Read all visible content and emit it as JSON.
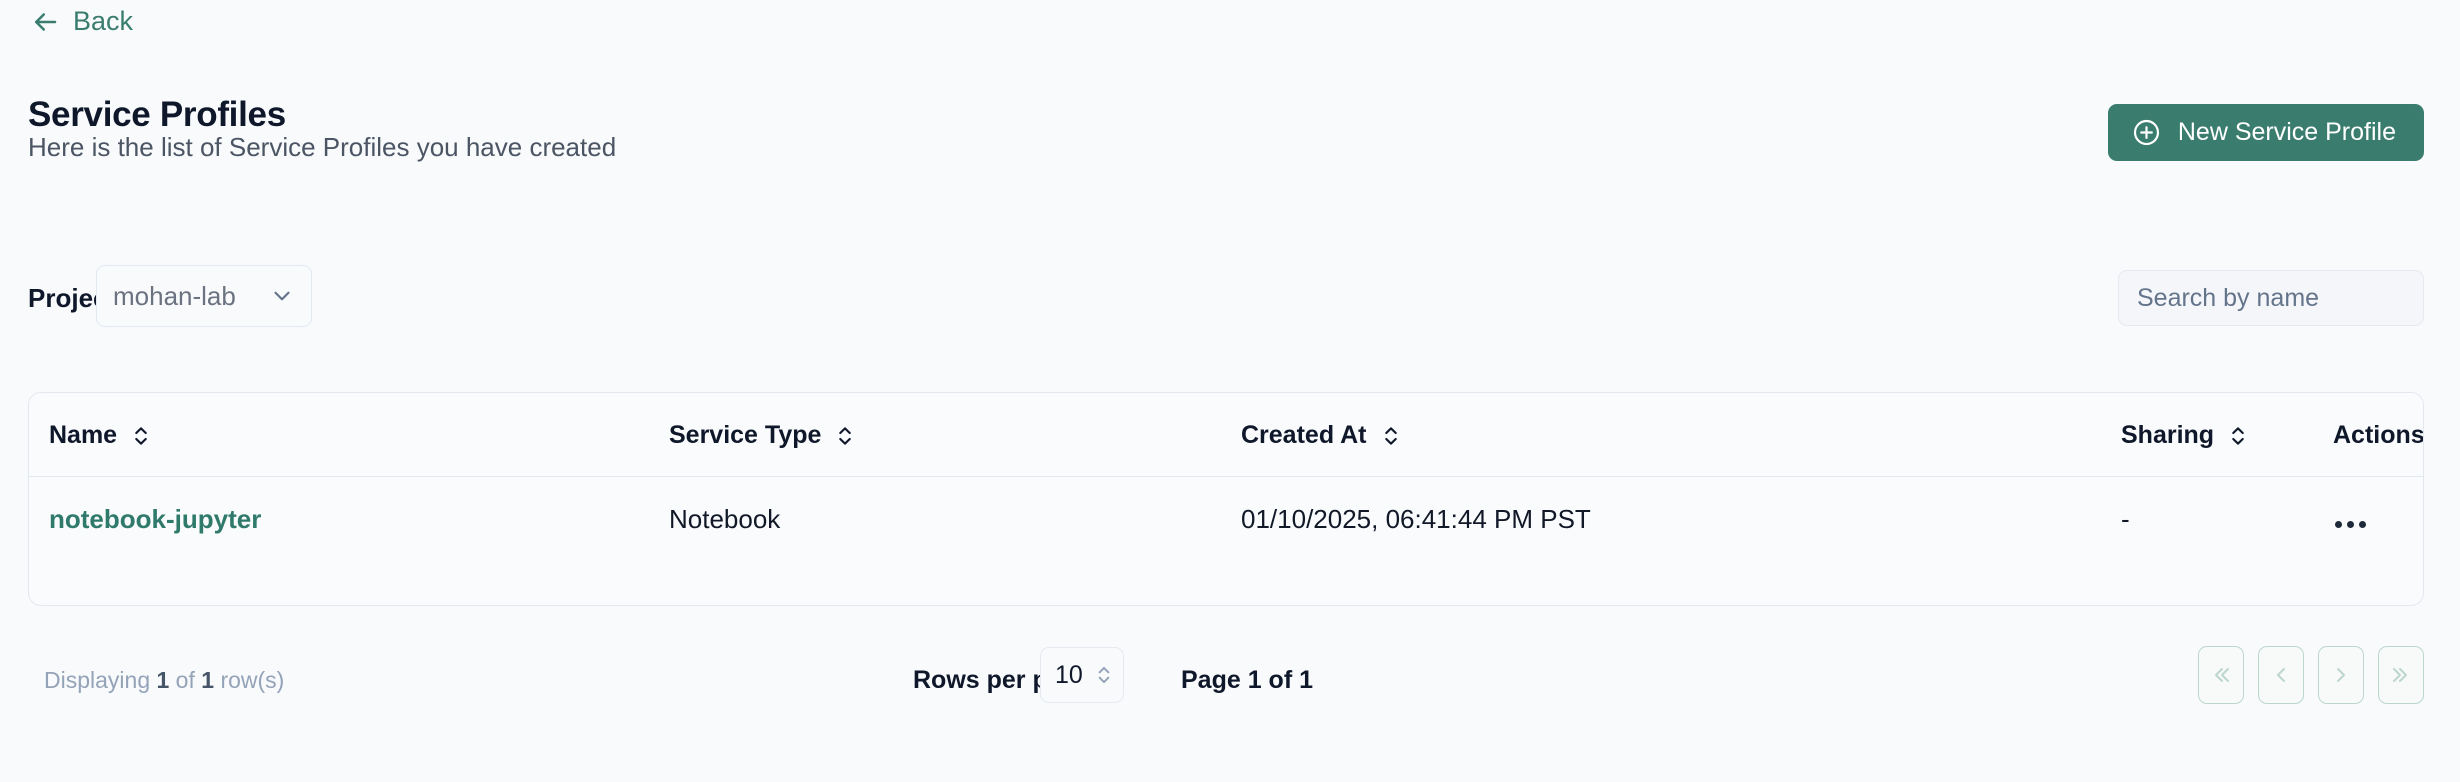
{
  "nav": {
    "back_label": "Back",
    "back_icon": "arrow-left-icon"
  },
  "header": {
    "title": "Service Profiles",
    "subtitle": "Here is the list of Service Profiles you have created",
    "primary_button": {
      "label": "New Service Profile",
      "icon": "plus-circle-icon",
      "color": "#3a7d6f"
    }
  },
  "filters": {
    "project_label": "Project",
    "project_value": "mohan-lab",
    "project_chevron_icon": "chevron-down-icon",
    "search_placeholder": "Search by name",
    "search_value": ""
  },
  "table": {
    "columns": [
      {
        "label": "Name",
        "sortable": true,
        "sort_icon": "chevron-up-down-icon"
      },
      {
        "label": "Service Type",
        "sortable": true,
        "sort_icon": "chevron-up-down-icon"
      },
      {
        "label": "Created At",
        "sortable": true,
        "sort_icon": "chevron-up-down-icon"
      },
      {
        "label": "Sharing",
        "sortable": true,
        "sort_icon": "chevron-up-down-icon"
      },
      {
        "label": "Actions",
        "sortable": false,
        "sort_icon": ""
      }
    ],
    "rows": [
      {
        "name": "notebook-jupyter",
        "service_type": "Notebook",
        "created_at": "01/10/2025, 06:41:44 PM PST",
        "sharing": "-",
        "actions_icon": "ellipsis-horizontal-icon"
      }
    ]
  },
  "footer": {
    "displaying_prefix": "Displaying ",
    "displaying_shown": "1",
    "displaying_middle": " of ",
    "displaying_total": "1",
    "displaying_suffix": " row(s)",
    "rows_per_page_label": "Rows per page",
    "rows_per_page_value": "10",
    "rows_per_page_icon": "chevron-up-down-icon",
    "page_label": "Page 1 of 1",
    "pagination": [
      {
        "name": "first-page",
        "icon": "chevron-double-left-icon"
      },
      {
        "name": "previous-page",
        "icon": "chevron-left-icon"
      },
      {
        "name": "next-page",
        "icon": "chevron-right-icon"
      },
      {
        "name": "last-page",
        "icon": "chevron-double-right-icon"
      }
    ]
  }
}
